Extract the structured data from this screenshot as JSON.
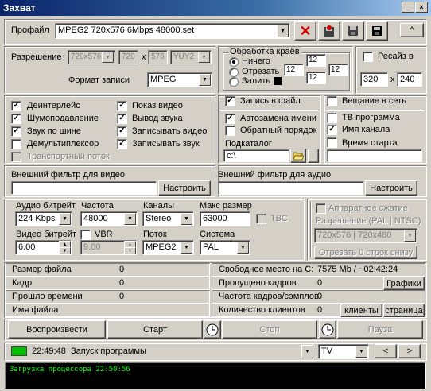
{
  "window": {
    "title": "Захват",
    "minimize": "_",
    "close": "×"
  },
  "profile": {
    "label": "Профайл",
    "value": "MPEG2 720x576 6Mbps 48000.set",
    "collapse": "^"
  },
  "resolution": {
    "label": "Разрешение",
    "preset": "720x576",
    "width": "720",
    "height": "576",
    "x": "x",
    "colorspace": "YUY2",
    "format_label": "Формат записи",
    "format": "MPEG"
  },
  "crop": {
    "title": "Обработка краёв",
    "options": [
      "Ничего",
      "Отрезать",
      "Залить"
    ],
    "selected": 0,
    "top": "12",
    "left": "12",
    "right": "12",
    "bottom": "12"
  },
  "resize": {
    "label": "Ресайз в",
    "width": "320",
    "height": "240",
    "x": "x"
  },
  "options": {
    "deinterlace": "Деинтерлейс",
    "denoise": "Шумоподавление",
    "audio_bus": "Звук по шине",
    "demux": "Демультиплексор",
    "transport": "Транспортный поток",
    "show_video": "Показ видео",
    "audio_out": "Вывод звука",
    "record_video": "Записывать видео",
    "record_audio": "Записывать звук"
  },
  "file": {
    "record_label": "Запись в файл",
    "auto_rename": "Автозамена имени",
    "reverse_order": "Обратный порядок",
    "subdir_label": "Подкаталог",
    "subdir": "c:\\"
  },
  "broadcast": {
    "label": "Вещание в сеть",
    "tv_program": "ТВ программа",
    "channel_name": "Имя канала",
    "start_time": "Время старта"
  },
  "filters": {
    "video_label": "Внешний фильтр для видео",
    "audio_label": "Внешний фильтр для аудио",
    "configure": "Настроить"
  },
  "encoding": {
    "audio_bitrate_label": "Аудио битрейт",
    "audio_bitrate": "224 Kbps",
    "frequency_label": "Частота",
    "frequency": "48000",
    "channels_label": "Каналы",
    "channels": "Stereo",
    "max_size_label": "Макс размер",
    "max_size": "63000",
    "tbc": "TBC",
    "video_bitrate_label": "Видео битрейт",
    "video_bitrate": "6.00",
    "vbr": "VBR",
    "vbr_value": "9.00",
    "stream_label": "Поток",
    "stream": "MPEG2",
    "system_label": "Система",
    "system": "PAL"
  },
  "hw": {
    "label": "Аппаратное сжатие",
    "res_label": "Разрешение (PAL | NTSC)",
    "res": "720x576 | 720x480",
    "crop_btn": "Отрезать 0 строк снизу"
  },
  "stats": {
    "file_size_label": "Размер файла",
    "file_size": "0",
    "frame_label": "Кадр",
    "frame": "0",
    "elapsed_label": "Прошло времени",
    "elapsed": "0",
    "filename_label": "Имя файла",
    "free_space_label": "Свободное место на C:",
    "free_space": "7575 Mb / ~02:42:24",
    "dropped_label": "Пропущено кадров",
    "dropped": "0",
    "rate_label": "Частота кадров/сэмплов",
    "rate": "0",
    "clients_label": "Количество клиентов",
    "clients": "0",
    "graphs_btn": "Графики",
    "clients_btn": "клиенты",
    "page_btn": "страница"
  },
  "controls": {
    "play": "Воспроизвести",
    "start": "Старт",
    "stop": "Стоп",
    "pause": "Пауза"
  },
  "statusbar": {
    "time": "22:49:48",
    "message": "Запуск программы",
    "source": "TV",
    "prev": "<",
    "next": ">",
    "indicator_color": "#00c000"
  },
  "log": {
    "line": "Загрузка процессора 22:50:56",
    "color": "#00ff00"
  }
}
